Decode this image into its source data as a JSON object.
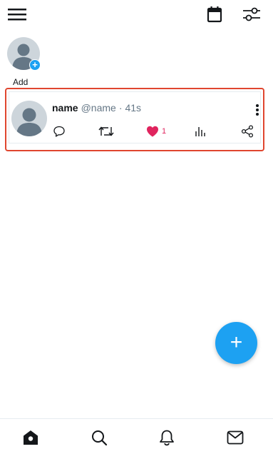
{
  "colors": {
    "accent": "#1da1f2",
    "like": "#e0245e",
    "highlight_border": "#e0462f",
    "muted_text": "#657786"
  },
  "header": {
    "menu_icon": "hamburger-menu-icon",
    "calendar_icon": "calendar-icon",
    "filter_icon": "sliders-icon"
  },
  "accounts": {
    "add_label": "Add",
    "add_badge": "+"
  },
  "tweet": {
    "name": "name",
    "handle": "@name",
    "separator": "·",
    "time": "41s",
    "like_count": "1",
    "liked": true,
    "actions": [
      "reply-icon",
      "retweet-icon",
      "heart-icon",
      "stats-icon",
      "share-icon"
    ]
  },
  "fab": {
    "label": "+"
  },
  "bottom_nav": {
    "items": [
      "home-icon",
      "search-icon",
      "bell-icon",
      "mail-icon"
    ],
    "active": "home-icon"
  }
}
